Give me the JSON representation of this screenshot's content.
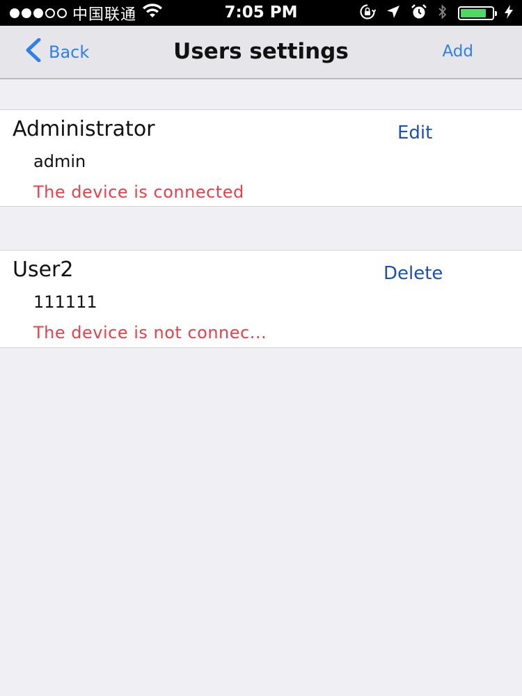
{
  "status_bar": {
    "carrier": "中国联通",
    "time": "7:05 PM"
  },
  "nav": {
    "back_label": "Back",
    "title": "Users settings",
    "add_label": "Add"
  },
  "users": [
    {
      "name": "Administrator",
      "account": "admin",
      "status": "The device is connected",
      "action": "Edit"
    },
    {
      "name": "User2",
      "account": "111111",
      "status": "The device is not connec...",
      "action": "Delete"
    }
  ],
  "colors": {
    "accent": "#2f80ed",
    "action": "#1d4fb8",
    "status_error": "#e8414b",
    "battery": "#4cd964",
    "background": "#efeff4"
  }
}
